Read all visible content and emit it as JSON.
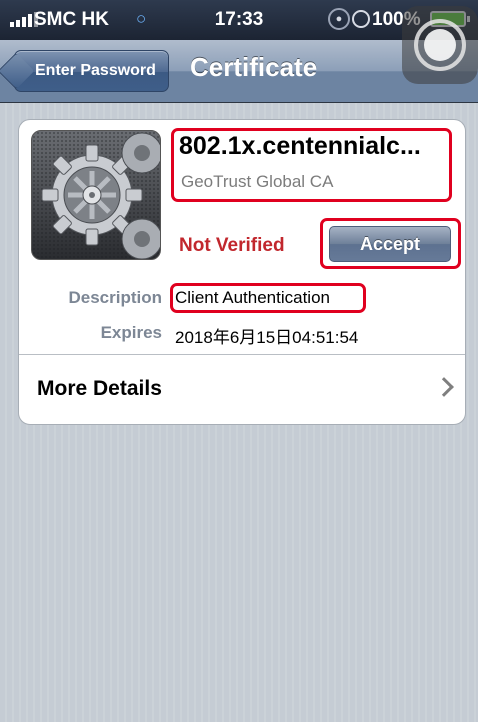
{
  "status_bar": {
    "carrier": "SMC HK",
    "time": "17:33",
    "battery": "100%",
    "icons": [
      "signal-bars-icon",
      "wifi-icon",
      "rotation-lock-icon",
      "alarm-icon",
      "battery-charging-icon"
    ]
  },
  "nav": {
    "back_label": "Enter Password",
    "title": "Certificate"
  },
  "certificate": {
    "name": "802.1x.centennialc...",
    "issuer": "GeoTrust Global CA",
    "status": "Not Verified",
    "accept_label": "Accept",
    "fields": [
      {
        "label": "Description",
        "value": "Client Authentication"
      },
      {
        "label": "Expires",
        "value": "2018年6月15日04:51:54"
      }
    ],
    "more_details_label": "More Details"
  },
  "colors": {
    "not_verified": "#c1272d",
    "highlight_box": "#e0001f",
    "nav_bar": "#6d84a2",
    "background": "#c5ccd4"
  }
}
